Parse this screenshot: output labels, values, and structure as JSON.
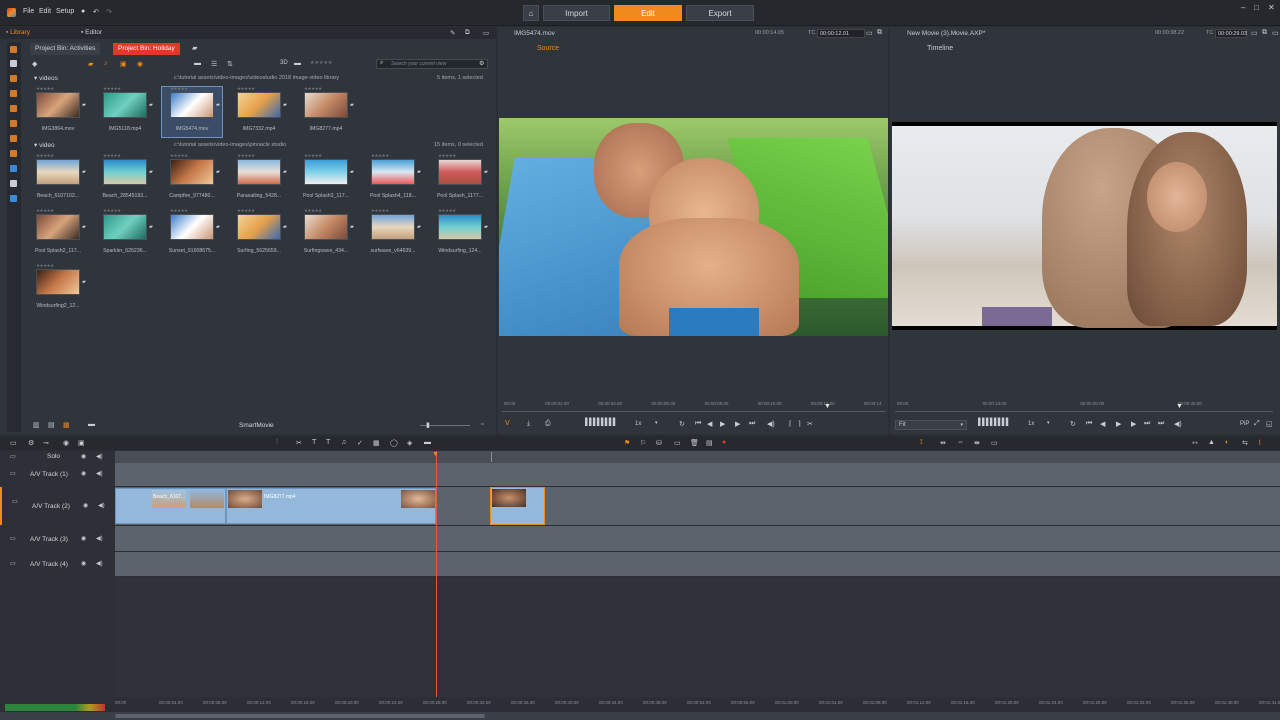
{
  "app": {
    "menu": [
      "File",
      "Edit",
      "Setup"
    ],
    "modes": [
      "Import",
      "Edit",
      "Export"
    ],
    "active_mode": "Edit",
    "window_controls": [
      "–",
      "□",
      "✕"
    ]
  },
  "library": {
    "tabs": [
      "Library",
      "Editor"
    ],
    "active_tab": "Library",
    "bins": [
      "Project Bin: Activities",
      "Project Bin: Holiday"
    ],
    "active_bin": "Project Bin: Holiday",
    "search_placeholder": "Search your current view",
    "view_3d": "3D",
    "folder1": {
      "name": "videos",
      "path": "c:\\tutorial assets\\video-images\\videostudio 2018 image-video library",
      "count": "5 items, 1 selected",
      "items": [
        "IMG3864.mov",
        "IMG5118.mp4",
        "IMG5474.mov",
        "IMG7332.mp4",
        "IMG8277.mp4"
      ]
    },
    "folder2": {
      "name": "video",
      "path": "c:\\tutorial assets\\video-images\\pinnacle studio",
      "count": "15 items, 0 selected",
      "items": [
        "Beach_6107102...",
        "Beach_28545193...",
        "Campfire_977480...",
        "Parasailing_5428...",
        "Pool Splash3_117...",
        "Pool Splash4_118...",
        "Pool Splash_1177...",
        "Pool Splash2_117...",
        "Sparkler_625236...",
        "Sunset_91608675...",
        "Surfing_5625659...",
        "Surfingwave_434...",
        "surfwave_v64639...",
        "Windsurfing_124...",
        "Windsurfing2_12..."
      ]
    },
    "smartmovie": "SmartMovie"
  },
  "source_player": {
    "title": "IMG5474.mov",
    "tab": "Source",
    "duration": "00:00:14.05",
    "tc_label": "TC",
    "timecode": "00:00:12.01",
    "ruler": [
      "00:00",
      "00:00:02.00",
      "00:00:04.00",
      "00:00:06.00",
      "00:00:08.00",
      "00:00:10.00",
      "00:00:12.00",
      "00:00:14"
    ],
    "speed": "1x",
    "progress": 0.85
  },
  "timeline_player": {
    "title": "New Movie (3).Movie.AXP*",
    "tab": "Timeline",
    "duration": "00:00:38.22",
    "tc_label": "TC",
    "timecode": "00:00:29.03",
    "ruler": [
      "00:00",
      "00:00:10.00",
      "00:00:20.00",
      "00:00:30.00"
    ],
    "fit": "Fit",
    "speed": "1x",
    "pip": "PiP",
    "progress": 0.75
  },
  "timeline": {
    "solo": "Solo",
    "tracks": [
      "A/V Track (1)",
      "A/V Track (2)",
      "A/V Track (3)",
      "A/V Track (4)"
    ],
    "clips": [
      {
        "label": "Beach_6107..."
      },
      {
        "label": "IMG8277.mp4"
      }
    ],
    "ruler": [
      "00:00",
      "00:00:04.00",
      "00:00:08.00",
      "00:00:12.00",
      "00:00:16.00",
      "00:00:20.00",
      "00:00:24.00",
      "00:00:28.00",
      "00:00:32.00",
      "00:00:36.00",
      "00:00:40.00",
      "00:00:44.00",
      "00:00:48.00",
      "00:00:52.00",
      "00:00:56.00",
      "00:01:00.00",
      "00:01:04.00",
      "00:01:08.00",
      "00:01:12.00",
      "00:01:16.00",
      "00:01:20.00",
      "00:01:24.00",
      "00:01:28.00",
      "00:01:32.00",
      "00:01:36.00",
      "00:01:40.00",
      "00:01:44.00"
    ]
  },
  "colors": {
    "accent": "#f08a1c",
    "bin_active": "#e0392a",
    "clip": "#93b8dc",
    "playhead": "#e35a3a"
  }
}
